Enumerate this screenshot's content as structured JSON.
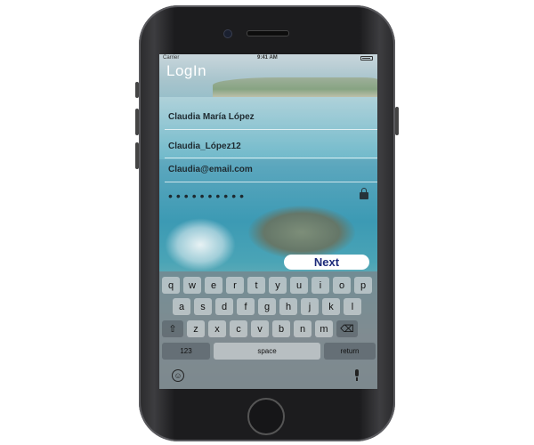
{
  "status_bar": {
    "carrier": "Carrier",
    "time": "9:41 AM"
  },
  "header": {
    "title": "LogIn"
  },
  "form": {
    "full_name": "Claudia María López",
    "username": "Claudia_López12",
    "email": "Claudia@email.com",
    "password_mask": "••••••••••",
    "next_label": "Next"
  },
  "keyboard": {
    "row1": [
      "q",
      "w",
      "e",
      "r",
      "t",
      "y",
      "u",
      "i",
      "o",
      "p"
    ],
    "row2": [
      "a",
      "s",
      "d",
      "f",
      "g",
      "h",
      "j",
      "k",
      "l"
    ],
    "row3": [
      "z",
      "x",
      "c",
      "v",
      "b",
      "n",
      "m"
    ],
    "shift_glyph": "⇧",
    "delete_glyph": "⌫",
    "numbers_label": "123",
    "space_label": "space",
    "return_label": "return",
    "emoji_glyph": "☺"
  },
  "icons": {
    "lock": "lock-icon",
    "mic": "microphone-icon",
    "emoji": "emoji-icon"
  }
}
